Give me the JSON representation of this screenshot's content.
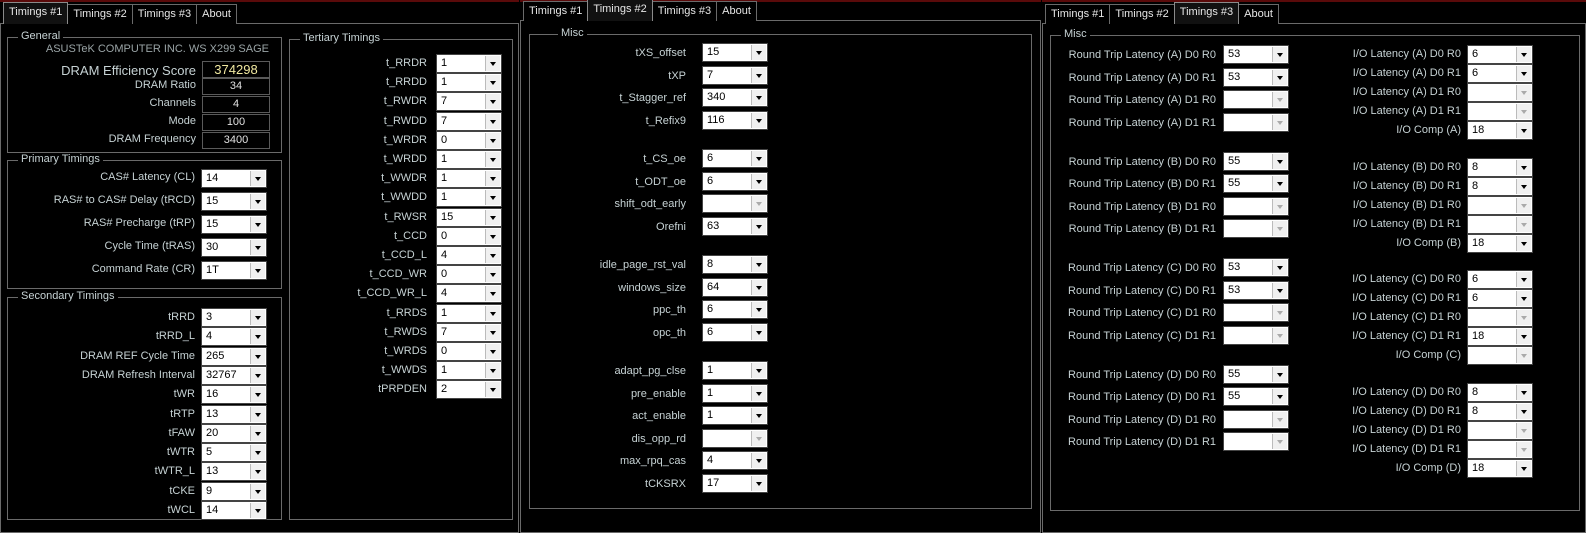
{
  "win1": {
    "tabs": [
      "Timings #1",
      "Timings #2",
      "Timings #3",
      "About"
    ],
    "general": {
      "title": "General",
      "board": "ASUSTeK COMPUTER INC. WS X299 SAGE",
      "efficiency_label": "DRAM Efficiency Score",
      "efficiency_value": "374298",
      "rows": [
        {
          "label": "DRAM Ratio",
          "value": "34"
        },
        {
          "label": "Channels",
          "value": "4"
        },
        {
          "label": "Mode",
          "value": "100"
        },
        {
          "label": "DRAM Frequency",
          "value": "3400"
        }
      ]
    },
    "primary": {
      "title": "Primary Timings",
      "rows": [
        {
          "label": "CAS# Latency (CL)",
          "value": "14"
        },
        {
          "label": "RAS# to CAS# Delay (tRCD)",
          "value": "15"
        },
        {
          "label": "RAS# Precharge (tRP)",
          "value": "15"
        },
        {
          "label": "Cycle Time (tRAS)",
          "value": "30"
        },
        {
          "label": "Command Rate (CR)",
          "value": "1T"
        }
      ]
    },
    "secondary": {
      "title": "Secondary Timings",
      "rows": [
        {
          "label": "tRRD",
          "value": "3"
        },
        {
          "label": "tRRD_L",
          "value": "4"
        },
        {
          "label": "DRAM REF Cycle Time",
          "value": "265"
        },
        {
          "label": "DRAM Refresh Interval",
          "value": "32767"
        },
        {
          "label": "tWR",
          "value": "16"
        },
        {
          "label": "tRTP",
          "value": "13"
        },
        {
          "label": "tFAW",
          "value": "20"
        },
        {
          "label": "tWTR",
          "value": "5"
        },
        {
          "label": "tWTR_L",
          "value": "13"
        },
        {
          "label": "tCKE",
          "value": "9"
        },
        {
          "label": "tWCL",
          "value": "14"
        }
      ]
    },
    "tertiary": {
      "title": "Tertiary Timings",
      "rows": [
        {
          "label": "t_RRDR",
          "value": "1"
        },
        {
          "label": "t_RRDD",
          "value": "1"
        },
        {
          "label": "t_RWDR",
          "value": "7"
        },
        {
          "label": "t_RWDD",
          "value": "7"
        },
        {
          "label": "t_WRDR",
          "value": "0"
        },
        {
          "label": "t_WRDD",
          "value": "1"
        },
        {
          "label": "t_WWDR",
          "value": "1"
        },
        {
          "label": "t_WWDD",
          "value": "1"
        },
        {
          "label": "t_RWSR",
          "value": "15"
        },
        {
          "label": "t_CCD",
          "value": "0"
        },
        {
          "label": "t_CCD_L",
          "value": "4"
        },
        {
          "label": "t_CCD_WR",
          "value": "0"
        },
        {
          "label": "t_CCD_WR_L",
          "value": "4"
        },
        {
          "label": "t_RRDS",
          "value": "1"
        },
        {
          "label": "t_RWDS",
          "value": "7"
        },
        {
          "label": "t_WRDS",
          "value": "0"
        },
        {
          "label": "t_WWDS",
          "value": "1"
        },
        {
          "label": "tPRPDEN",
          "value": "2"
        }
      ]
    }
  },
  "win2": {
    "tabs": [
      "Timings #1",
      "Timings #2",
      "Timings #3",
      "About"
    ],
    "misc_title": "Misc",
    "rows": [
      {
        "label": "tXS_offset",
        "value": "15"
      },
      {
        "label": "tXP",
        "value": "7"
      },
      {
        "label": "t_Stagger_ref",
        "value": "340"
      },
      {
        "label": "t_Refix9",
        "value": "116"
      },
      {
        "label": "t_CS_oe",
        "value": "6"
      },
      {
        "label": "t_ODT_oe",
        "value": "6"
      },
      {
        "label": "shift_odt_early",
        "value": ""
      },
      {
        "label": "Orefni",
        "value": "63"
      },
      {
        "label": "idle_page_rst_val",
        "value": "8"
      },
      {
        "label": "windows_size",
        "value": "64"
      },
      {
        "label": "ppc_th",
        "value": "6"
      },
      {
        "label": "opc_th",
        "value": "6"
      },
      {
        "label": "adapt_pg_clse",
        "value": "1"
      },
      {
        "label": "pre_enable",
        "value": "1"
      },
      {
        "label": "act_enable",
        "value": "1"
      },
      {
        "label": "dis_opp_rd",
        "value": ""
      },
      {
        "label": "max_rpq_cas",
        "value": "4"
      },
      {
        "label": "tCKSRX",
        "value": "17"
      }
    ]
  },
  "win3": {
    "tabs": [
      "Timings #1",
      "Timings #2",
      "Timings #3",
      "About"
    ],
    "misc_title": "Misc",
    "rtl": [
      {
        "label": "Round Trip Latency (A) D0 R0",
        "value": "53"
      },
      {
        "label": "Round Trip Latency (A) D0 R1",
        "value": "53"
      },
      {
        "label": "Round Trip Latency (A) D1 R0",
        "value": ""
      },
      {
        "label": "Round Trip Latency (A) D1 R1",
        "value": ""
      },
      {
        "label": "Round Trip Latency (B) D0 R0",
        "value": "55"
      },
      {
        "label": "Round Trip Latency (B) D0 R1",
        "value": "55"
      },
      {
        "label": "Round Trip Latency (B) D1 R0",
        "value": ""
      },
      {
        "label": "Round Trip Latency (B) D1 R1",
        "value": ""
      },
      {
        "label": "Round Trip Latency (C) D0 R0",
        "value": "53"
      },
      {
        "label": "Round Trip Latency (C) D0 R1",
        "value": "53"
      },
      {
        "label": "Round Trip Latency (C) D1 R0",
        "value": ""
      },
      {
        "label": "Round Trip Latency (C) D1 R1",
        "value": ""
      },
      {
        "label": "Round Trip Latency (D) D0 R0",
        "value": "55"
      },
      {
        "label": "Round Trip Latency (D) D0 R1",
        "value": "55"
      },
      {
        "label": "Round Trip Latency (D) D1 R0",
        "value": ""
      },
      {
        "label": "Round Trip Latency (D) D1 R1",
        "value": ""
      }
    ],
    "io": [
      {
        "label": "I/O Latency (A) D0 R0",
        "value": "6"
      },
      {
        "label": "I/O Latency (A) D0 R1",
        "value": "6"
      },
      {
        "label": "I/O Latency (A) D1 R0",
        "value": ""
      },
      {
        "label": "I/O Latency (A) D1 R1",
        "value": ""
      },
      {
        "label": "I/O Comp (A)",
        "value": "18"
      },
      {
        "label": "I/O Latency (B) D0 R0",
        "value": "8"
      },
      {
        "label": "I/O Latency (B) D0 R1",
        "value": "8"
      },
      {
        "label": "I/O Latency (B) D1 R0",
        "value": ""
      },
      {
        "label": "I/O Latency (B) D1 R1",
        "value": ""
      },
      {
        "label": "I/O Comp (B)",
        "value": "18"
      },
      {
        "label": "I/O Latency (C) D0 R0",
        "value": "6"
      },
      {
        "label": "I/O Latency (C) D0 R1",
        "value": "6"
      },
      {
        "label": "I/O Latency (C) D1 R0",
        "value": ""
      },
      {
        "label": "I/O Latency (C) D1 R1",
        "value": "18"
      },
      {
        "label": "I/O Comp (C)",
        "value": ""
      },
      {
        "label": "I/O Latency (D) D0 R0",
        "value": "8"
      },
      {
        "label": "I/O Latency (D) D0 R1",
        "value": "8"
      },
      {
        "label": "I/O Latency (D) D1 R0",
        "value": ""
      },
      {
        "label": "I/O Latency (D) D1 R1",
        "value": ""
      },
      {
        "label": "I/O Comp (D)",
        "value": "18"
      }
    ]
  }
}
